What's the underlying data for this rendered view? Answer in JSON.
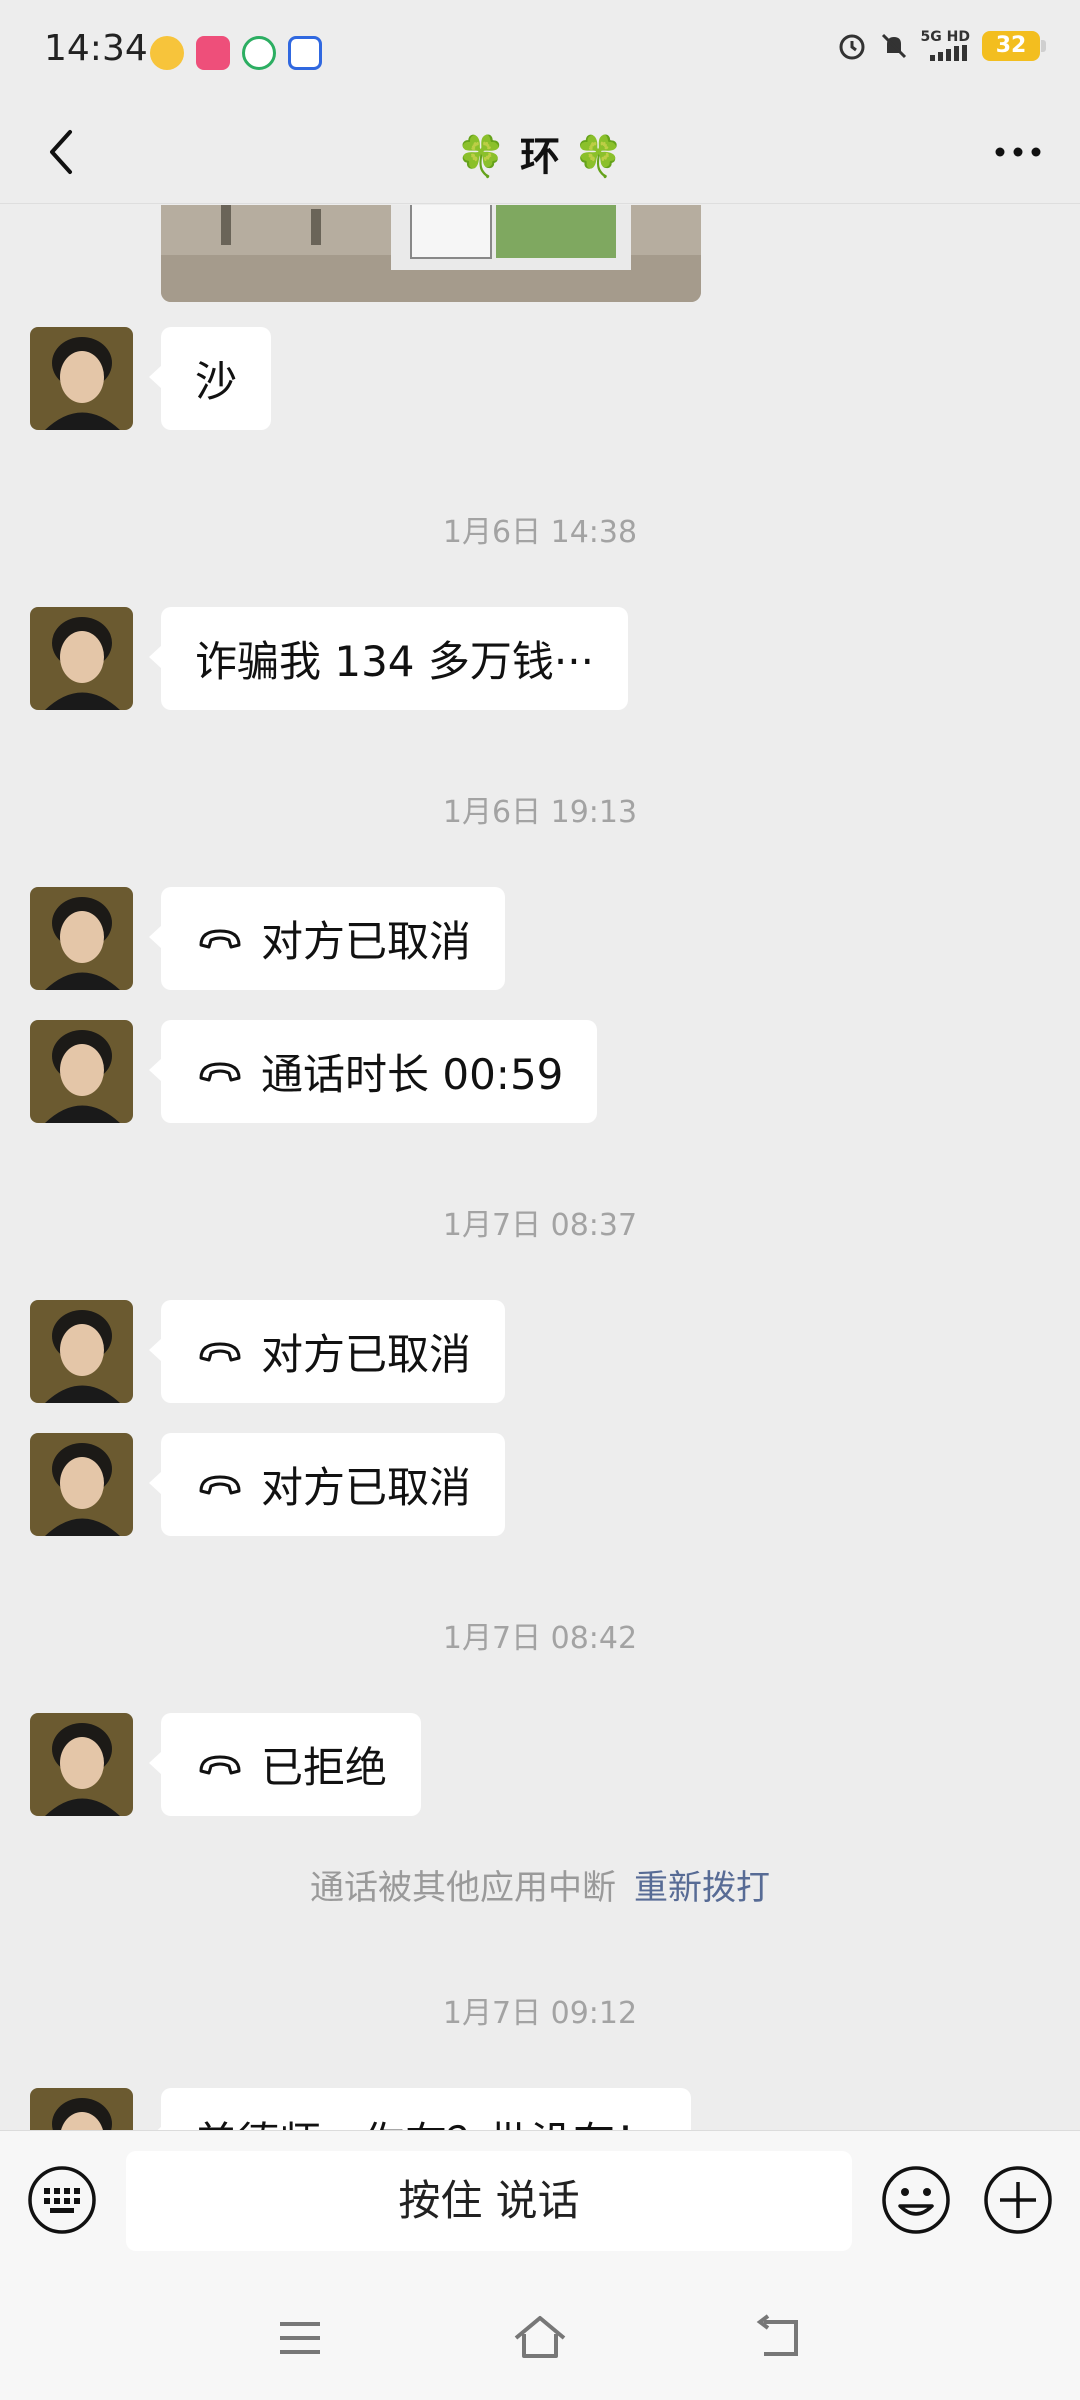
{
  "status_bar": {
    "time": "14:34",
    "network_top": "5G HD",
    "battery": "32",
    "app_icons": [
      "weibo-icon",
      "app-icon",
      "green-app-icon",
      "baidu-icon"
    ],
    "right_icons": [
      "alarm-icon",
      "mute-icon",
      "signal-icon"
    ]
  },
  "header": {
    "title": "🍀 环 🍀",
    "back_icon": "chevron-left-icon",
    "more_icon": "more-icon"
  },
  "messages": [
    {
      "type": "image"
    },
    {
      "type": "text",
      "text": "沙"
    },
    {
      "type": "timestamp",
      "text": "1月6日 14:38"
    },
    {
      "type": "text",
      "text": "诈骗我 134 多万钱···"
    },
    {
      "type": "timestamp",
      "text": "1月6日 19:13"
    },
    {
      "type": "call",
      "text": "对方已取消"
    },
    {
      "type": "call",
      "text": "通话时长 00:59"
    },
    {
      "type": "timestamp",
      "text": "1月7日 08:37"
    },
    {
      "type": "call",
      "text": "对方已取消"
    },
    {
      "type": "call",
      "text": "对方已取消"
    },
    {
      "type": "timestamp",
      "text": "1月7日 08:42"
    },
    {
      "type": "call",
      "text": "已拒绝"
    },
    {
      "type": "system",
      "text": "通话被其他应用中断",
      "action": "重新拨打"
    },
    {
      "type": "timestamp",
      "text": "1月7日 09:12"
    },
    {
      "type": "text",
      "text": "美德师，你在？批没有！"
    }
  ],
  "input_bar": {
    "talk_label": "按住 说话",
    "keyboard_icon": "keyboard-icon",
    "emoji_icon": "emoji-icon",
    "plus_icon": "plus-icon"
  },
  "nav_bar": {
    "icons": [
      "menu-icon",
      "home-icon",
      "back-icon"
    ]
  },
  "colors": {
    "background": "#ededed",
    "bubble": "#ffffff",
    "link": "#576b95",
    "timestamp": "#a3a3a3",
    "battery": "#f3be1f"
  }
}
